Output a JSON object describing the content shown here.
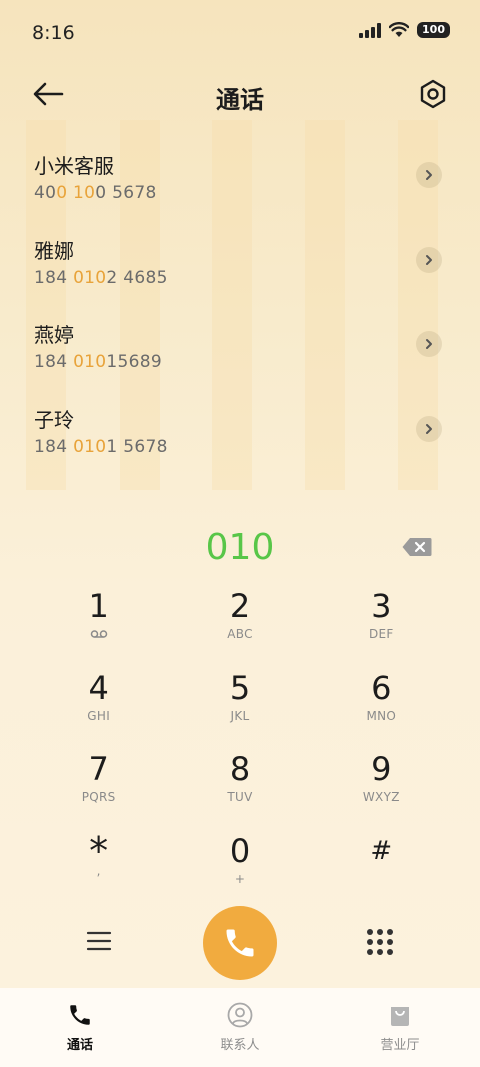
{
  "status_bar": {
    "time": "8:16",
    "battery": "100",
    "icons": [
      "signal-icon",
      "wifi-icon",
      "battery-icon"
    ]
  },
  "header": {
    "title": "通话",
    "back_icon": "back-arrow-icon",
    "settings_icon": "hexagon-settings-icon"
  },
  "contacts": [
    {
      "name": "小米客服",
      "number_parts": [
        {
          "t": "40",
          "hl": false
        },
        {
          "t": "0 10",
          "hl": true
        },
        {
          "t": "0 5678",
          "hl": false
        }
      ]
    },
    {
      "name": "雅娜",
      "number_parts": [
        {
          "t": "184 ",
          "hl": false
        },
        {
          "t": "010",
          "hl": true
        },
        {
          "t": "2 4685",
          "hl": false
        }
      ]
    },
    {
      "name": "燕婷",
      "number_parts": [
        {
          "t": "184 ",
          "hl": false
        },
        {
          "t": "010",
          "hl": true
        },
        {
          "t": "15689",
          "hl": false
        }
      ]
    },
    {
      "name": "子玲",
      "number_parts": [
        {
          "t": "184 ",
          "hl": false
        },
        {
          "t": "010",
          "hl": true
        },
        {
          "t": "1 5678",
          "hl": false
        }
      ]
    }
  ],
  "dialer": {
    "input_value": "010",
    "highlight_color": "#e8a33a",
    "input_color": "#58c648",
    "keys": [
      {
        "digit": "1",
        "sub": "",
        "sub_icon": "voicemail-icon"
      },
      {
        "digit": "2",
        "sub": "ABC"
      },
      {
        "digit": "3",
        "sub": "DEF"
      },
      {
        "digit": "4",
        "sub": "GHI"
      },
      {
        "digit": "5",
        "sub": "JKL"
      },
      {
        "digit": "6",
        "sub": "MNO"
      },
      {
        "digit": "7",
        "sub": "PQRS"
      },
      {
        "digit": "8",
        "sub": "TUV"
      },
      {
        "digit": "9",
        "sub": "WXYZ"
      },
      {
        "digit": "*",
        "sub": ","
      },
      {
        "digit": "0",
        "sub": "+"
      },
      {
        "digit": "#",
        "sub": ""
      }
    ]
  },
  "actions": {
    "call_color": "#f1ab3f"
  },
  "tabs": [
    {
      "label": "通话",
      "icon": "phone-icon",
      "active": true
    },
    {
      "label": "联系人",
      "icon": "person-icon",
      "active": false
    },
    {
      "label": "营业厅",
      "icon": "shopping-bag-icon",
      "active": false
    }
  ]
}
